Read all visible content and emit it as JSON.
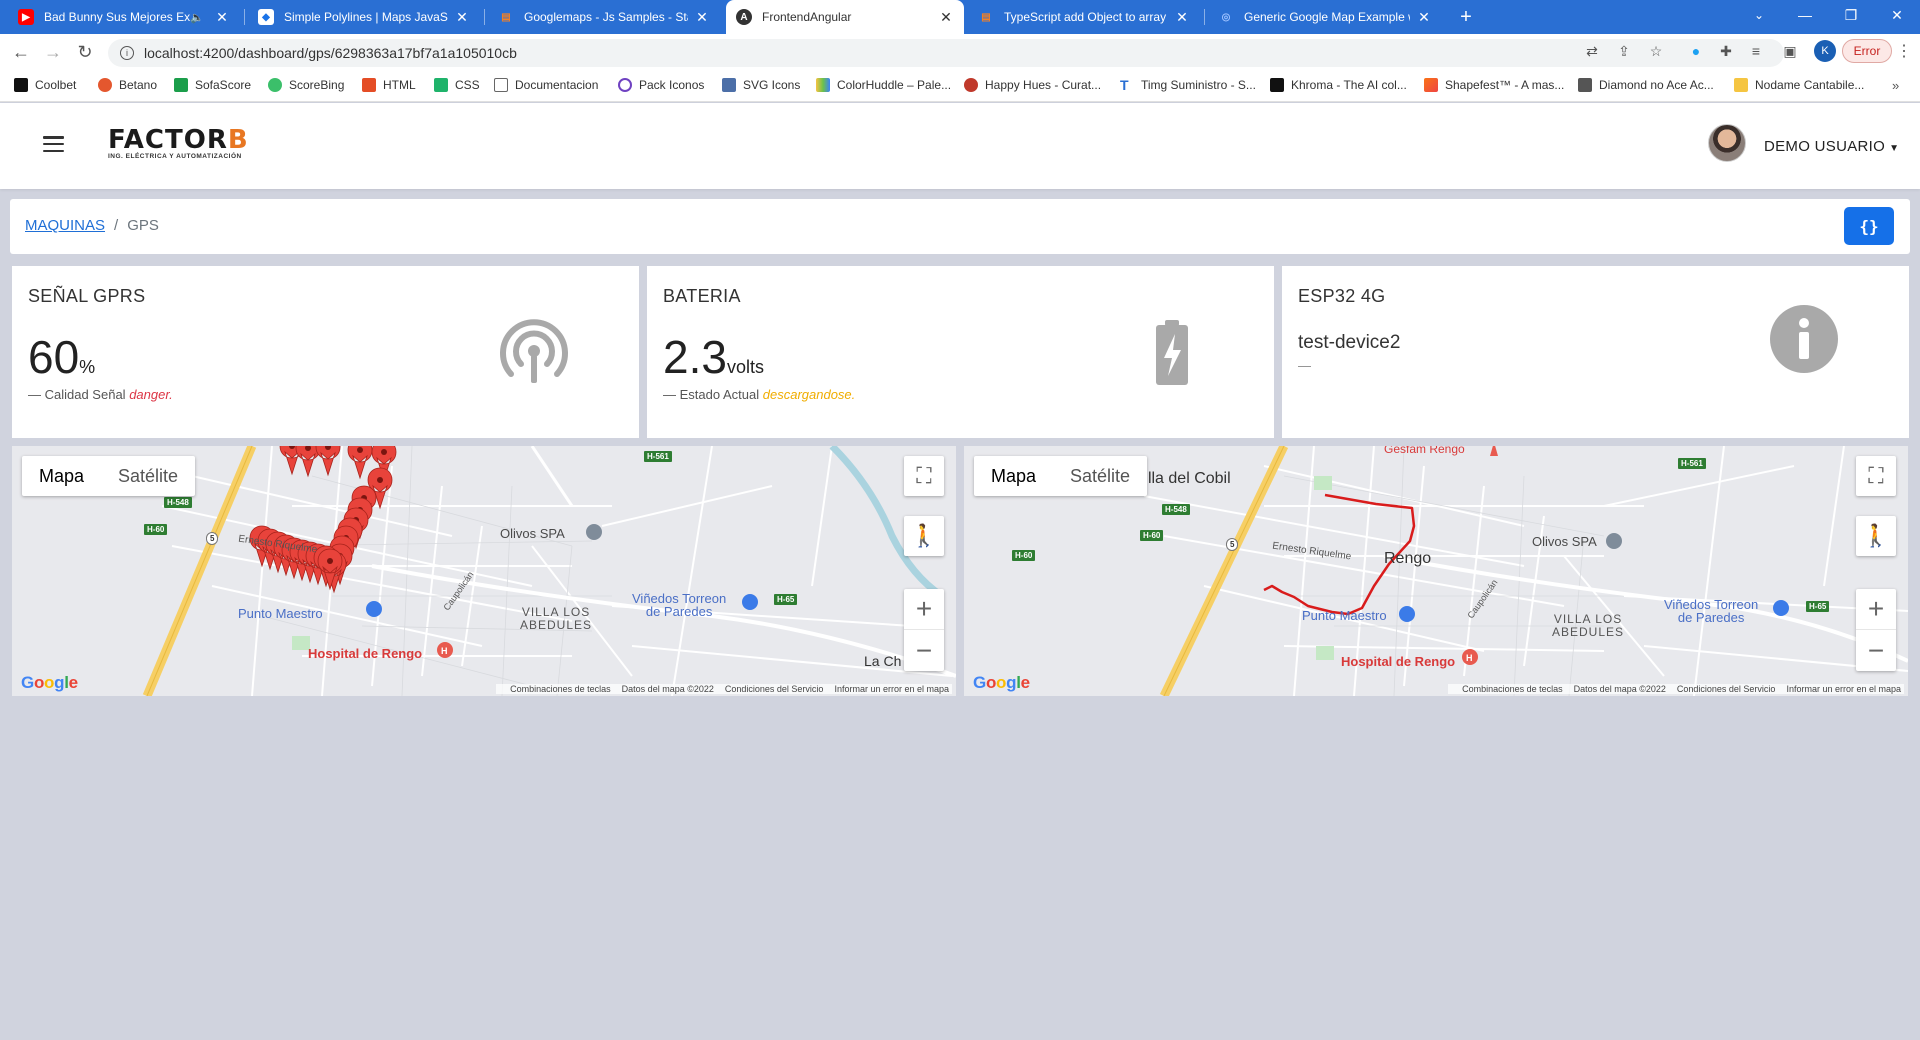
{
  "browser": {
    "tabs": [
      {
        "label": "Bad Bunny Sus Mejores Exitos",
        "favicon": "youtube-icon",
        "color": "#ff0000"
      },
      {
        "label": "Simple Polylines | Maps JavaScr...",
        "favicon": "maps-icon",
        "color": "#fbbc04"
      },
      {
        "label": "Googlemaps - Js Samples - Stack",
        "favicon": "stackoverflow-icon",
        "color": "#f48024"
      },
      {
        "label": "FrontendAngular",
        "favicon": "angular-icon",
        "color": "#dd0031"
      },
      {
        "label": "TypeScript add Object to array w...",
        "favicon": "stackoverflow-icon",
        "color": "#f48024"
      },
      {
        "label": "Generic Google Map Example wi...",
        "favicon": "globe-icon",
        "color": "#5b8def"
      }
    ],
    "url": "localhost:4200/dashboard/gps/6298363a17bf7a1a105010cb",
    "profile_initial": "K",
    "error_label": "Error",
    "bookmarks": [
      "Coolbet",
      "Betano",
      "SofaScore",
      "ScoreBing",
      "HTML",
      "CSS",
      "Documentacion",
      "Pack Iconos",
      "SVG Icons",
      "ColorHuddle – Pale...",
      "Happy Hues - Curat...",
      "Timg Suministro - S...",
      "Khroma - The AI col...",
      "Shapefest™ - A mas...",
      "Diamond no Ace Ac...",
      "Nodame Cantabile..."
    ]
  },
  "header": {
    "logo_main": "FACTOR",
    "logo_accent": "B",
    "logo_sub": "ING. ELÉCTRICA Y AUTOMATIZACIÓN",
    "user_name": "DEMO USUARIO"
  },
  "breadcrumb": {
    "parent": "MAQUINAS",
    "current": "GPS",
    "code_button": "{}"
  },
  "cards": {
    "signal": {
      "title": "SEÑAL GPRS",
      "value": "60",
      "unit": "%",
      "foot_label": "— Calidad Señal",
      "foot_status": "danger."
    },
    "battery": {
      "title": "BATERIA",
      "value": "2.3",
      "unit": "volts",
      "foot_label": "— Estado Actual",
      "foot_status": "descargandose."
    },
    "device": {
      "title": "ESP32 4G",
      "name": "test-device2",
      "foot": "—"
    }
  },
  "maps": {
    "map_tab": "Mapa",
    "satellite_tab": "Satélite",
    "google": "Google",
    "attribution": [
      "Combinaciones de teclas",
      "Datos del mapa ©2022",
      "Condiciones del Servicio",
      "Informar un error en el mapa"
    ],
    "labels": {
      "olivos": "Olivos SPA",
      "vinedos_1": "Viñedos Torreon",
      "vinedos_2": "de Paredes",
      "villa_1": "VILLA LOS",
      "villa_2": "ABEDULES",
      "hospital": "Hospital de Rengo",
      "punto": "Punto Maestro",
      "rengo": "Rengo",
      "riquelme": "Ernesto Riquelme",
      "cobil": "Villa del Cobil",
      "lach": "La Ch",
      "caupolican": "Caupolicán",
      "gesfam": "Gesfam Rengo",
      "h561": "H-561",
      "h548": "H-548",
      "h60": "H-60",
      "h65": "H-65",
      "r5": "5"
    }
  }
}
